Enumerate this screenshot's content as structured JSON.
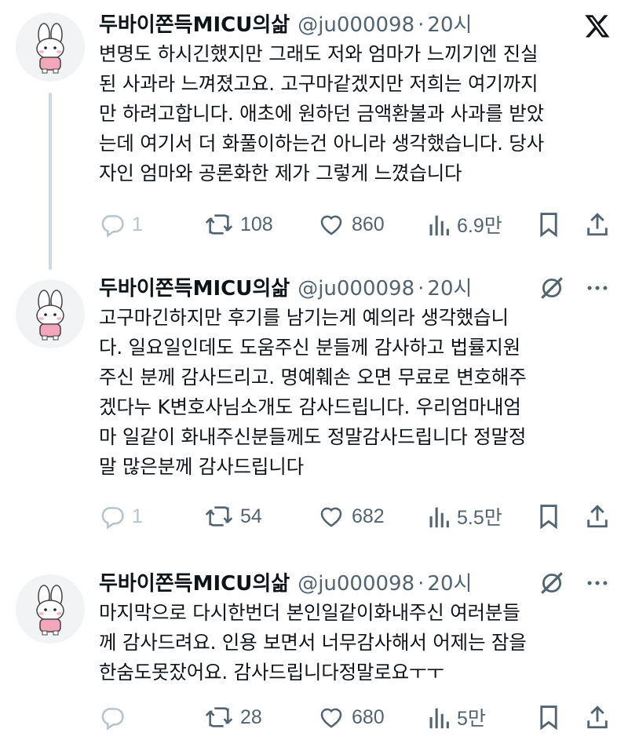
{
  "tweets": [
    {
      "name": "두바이쫀득MICU의삶",
      "handle": "@ju000098",
      "separator": "·",
      "time": "20시",
      "text": "변명도 하시긴했지만 그래도 저와 엄마가 느끼기엔 진실\n된 사과라 느껴졌고요. 고구마같겠지만 저희는 여기까지\n만 하려고합니다. 애초에 원하던 금액환불과 사과를 받았\n는데 여기서 더 화풀이하는건 아니라 생각했습니다. 당사\n자인 엄마와 공론화한 제가 그렇게 느꼈습니다",
      "replies": "1",
      "retweets": "108",
      "likes": "860",
      "views": "6.9만",
      "corner_icon": "x-logo-icon"
    },
    {
      "name": "두바이쫀득MICU의삶",
      "handle": "@ju000098",
      "separator": "·",
      "time": "20시",
      "text": "고구마긴하지만 후기를 남기는게 예의라 생각했습니\n다. 일요일인데도 도움주신 분들께 감사하고 법률지원\n주신 분께 감사드리고. 명예훼손 오면 무료로 변호해주\n겠다누 K변호사님소개도 감사드립니다. 우리엄마내엄\n마 일같이 화내주신분들께도 정말감사드립니다 정말정\n말 많은분께 감사드립니다",
      "replies": "1",
      "retweets": "54",
      "likes": "682",
      "views": "5.5만",
      "corner_icon": "grok-icon"
    },
    {
      "name": "두바이쫀득MICU의삶",
      "handle": "@ju000098",
      "separator": "·",
      "time": "20시",
      "text": "마지막으로 다시한번더 본인일같이화내주신 여러분들\n께 감사드려요. 인용 보면서 너무감사해서 어제는 잠을\n한숨도못잤어요. 감사드립니다정말로요ㅜㅜ",
      "replies": "",
      "retweets": "28",
      "likes": "680",
      "views": "5만",
      "corner_icon": "grok-icon"
    }
  ],
  "colors": {
    "text": "#0f1419",
    "secondary": "#536471",
    "reply_muted": "#b9c3ca",
    "thread_line": "#cfd9de"
  }
}
